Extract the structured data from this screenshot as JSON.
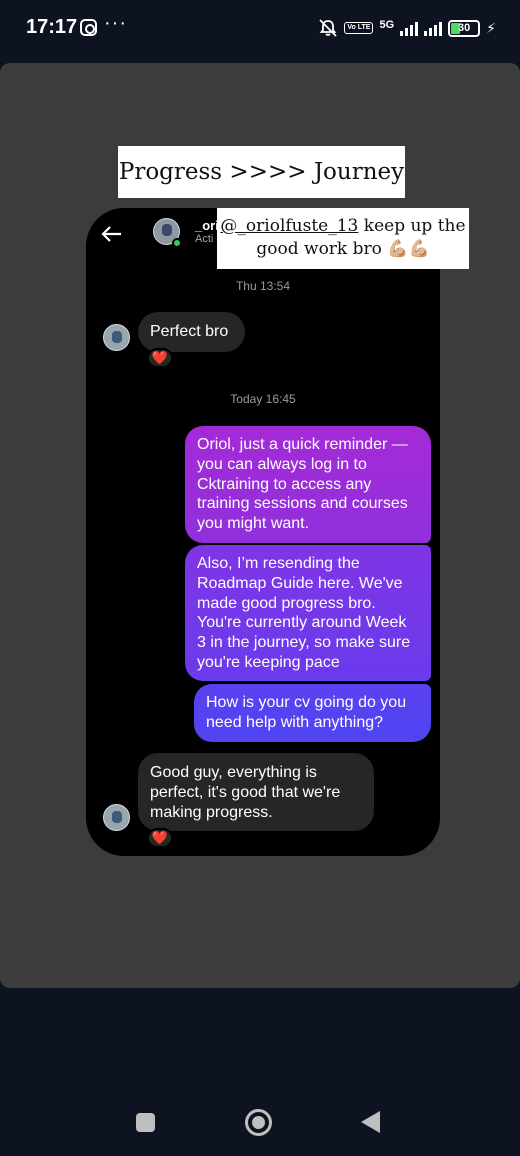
{
  "status_bar": {
    "time": "17:17",
    "overflow": "···",
    "volte": "Vo LTE",
    "network": "5G",
    "battery": "30",
    "icons": [
      "instagram-icon",
      "bell-off-icon",
      "signal-icon",
      "charging-icon"
    ]
  },
  "story": {
    "caption": "Progress >>>> Journey",
    "sticker": {
      "mention": "@_oriolfuste_13",
      "text_line1_rest": " keep up the",
      "text_line2": "good work bro 💪🏼💪🏼"
    }
  },
  "chat": {
    "header": {
      "name": "_ori",
      "status": "Acti"
    },
    "timestamps": [
      "Thu 13:54",
      "Today 16:45"
    ],
    "messages_in": [
      {
        "text": "Perfect bro",
        "reaction": "❤️"
      },
      {
        "text": "Good guy, everything is perfect, it's good that we're making progress.",
        "reaction": "❤️"
      }
    ],
    "messages_out": [
      "Oriol, just a quick reminder — you can always log in to Cktraining to access any training sessions and courses you might want.",
      "Also, I’m resending the Roadmap Guide here. We've made good progress bro. You're currently around Week 3 in the journey, so make sure you're keeping pace",
      "How is your cv going do you need help with anything?"
    ]
  },
  "colors": {
    "story_bg": "#3c3c3c",
    "chat_bg": "#000000",
    "incoming_bubble": "#262626",
    "outgoing_gradient": [
      "#a52ad7",
      "#4f45f2"
    ],
    "reaction_heart": "#e0283f"
  },
  "nav_bar": {
    "icons": [
      "recents-square-icon",
      "home-circle-icon",
      "back-triangle-icon"
    ]
  }
}
